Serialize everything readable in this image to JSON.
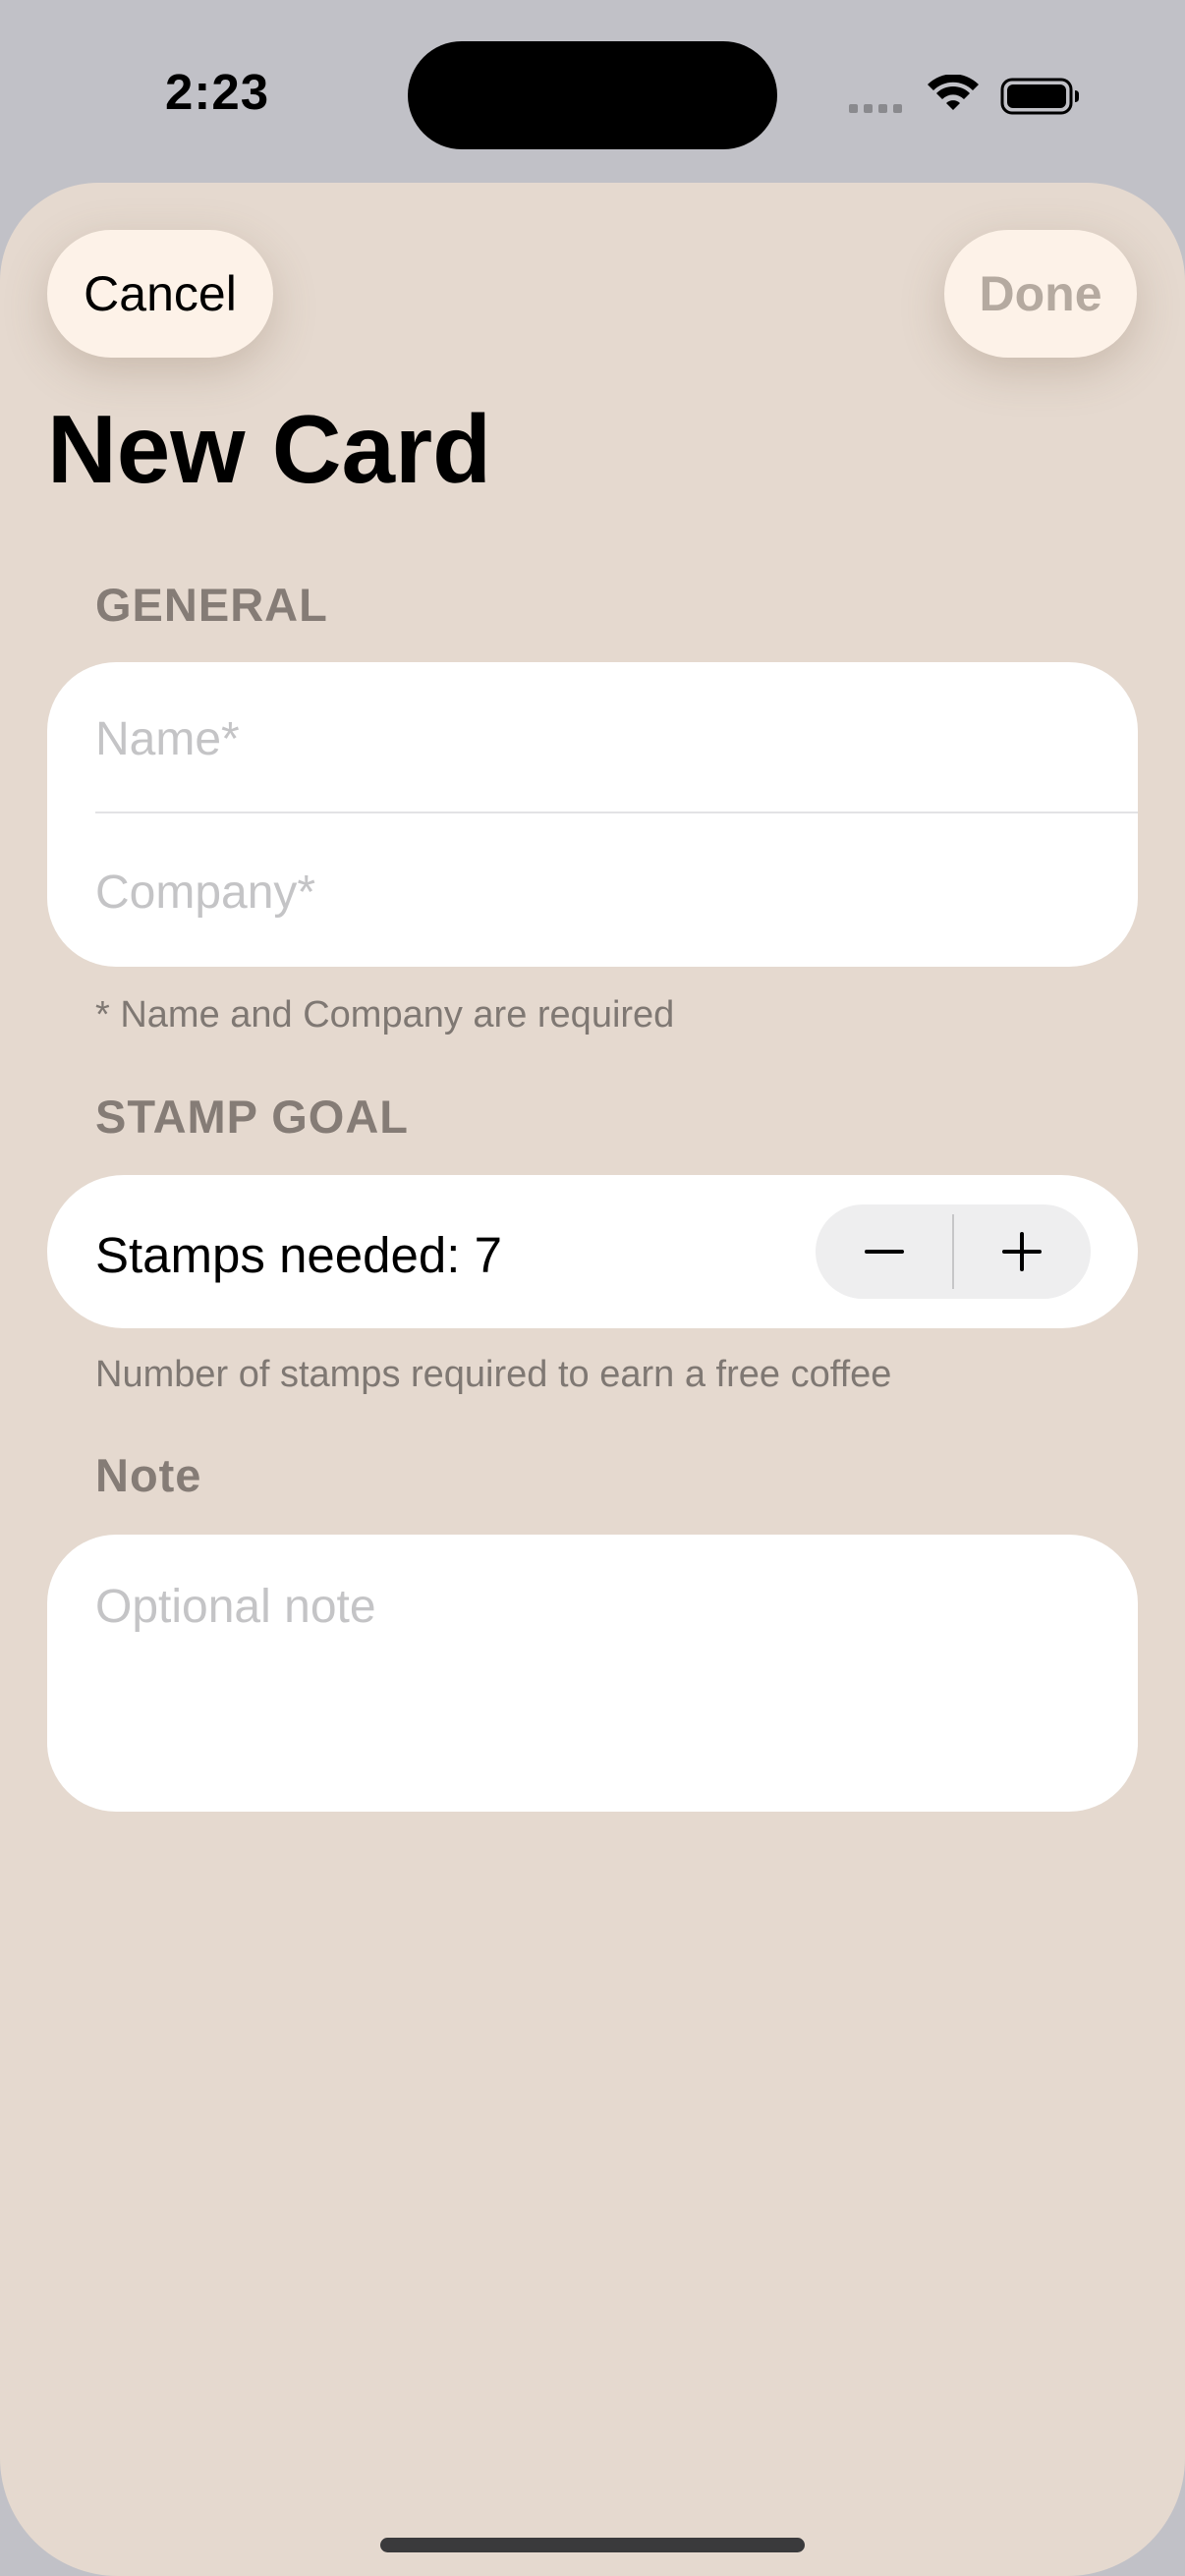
{
  "status_bar": {
    "time": "2:23",
    "icons": [
      "cellular-signal-icon",
      "wifi-icon",
      "battery-icon"
    ]
  },
  "toolbar": {
    "cancel_label": "Cancel",
    "done_label": "Done"
  },
  "title": "New Card",
  "general": {
    "header": "GENERAL",
    "name_placeholder": "Name*",
    "company_placeholder": "Company*",
    "footer": "* Name and Company are required"
  },
  "stamp_goal": {
    "header": "STAMP GOAL",
    "label": "Stamps needed: 7",
    "value": 7,
    "decrement_icon": "minus-icon",
    "increment_icon": "plus-icon",
    "footer": "Number of stamps required to earn a free coffee"
  },
  "note": {
    "header": "Note",
    "placeholder": "Optional note"
  },
  "colors": {
    "sheet_background": "#e5d9cf",
    "button_background": "#fdf2e8",
    "done_disabled_text": "#b5aaa0",
    "section_header": "#857c76"
  }
}
